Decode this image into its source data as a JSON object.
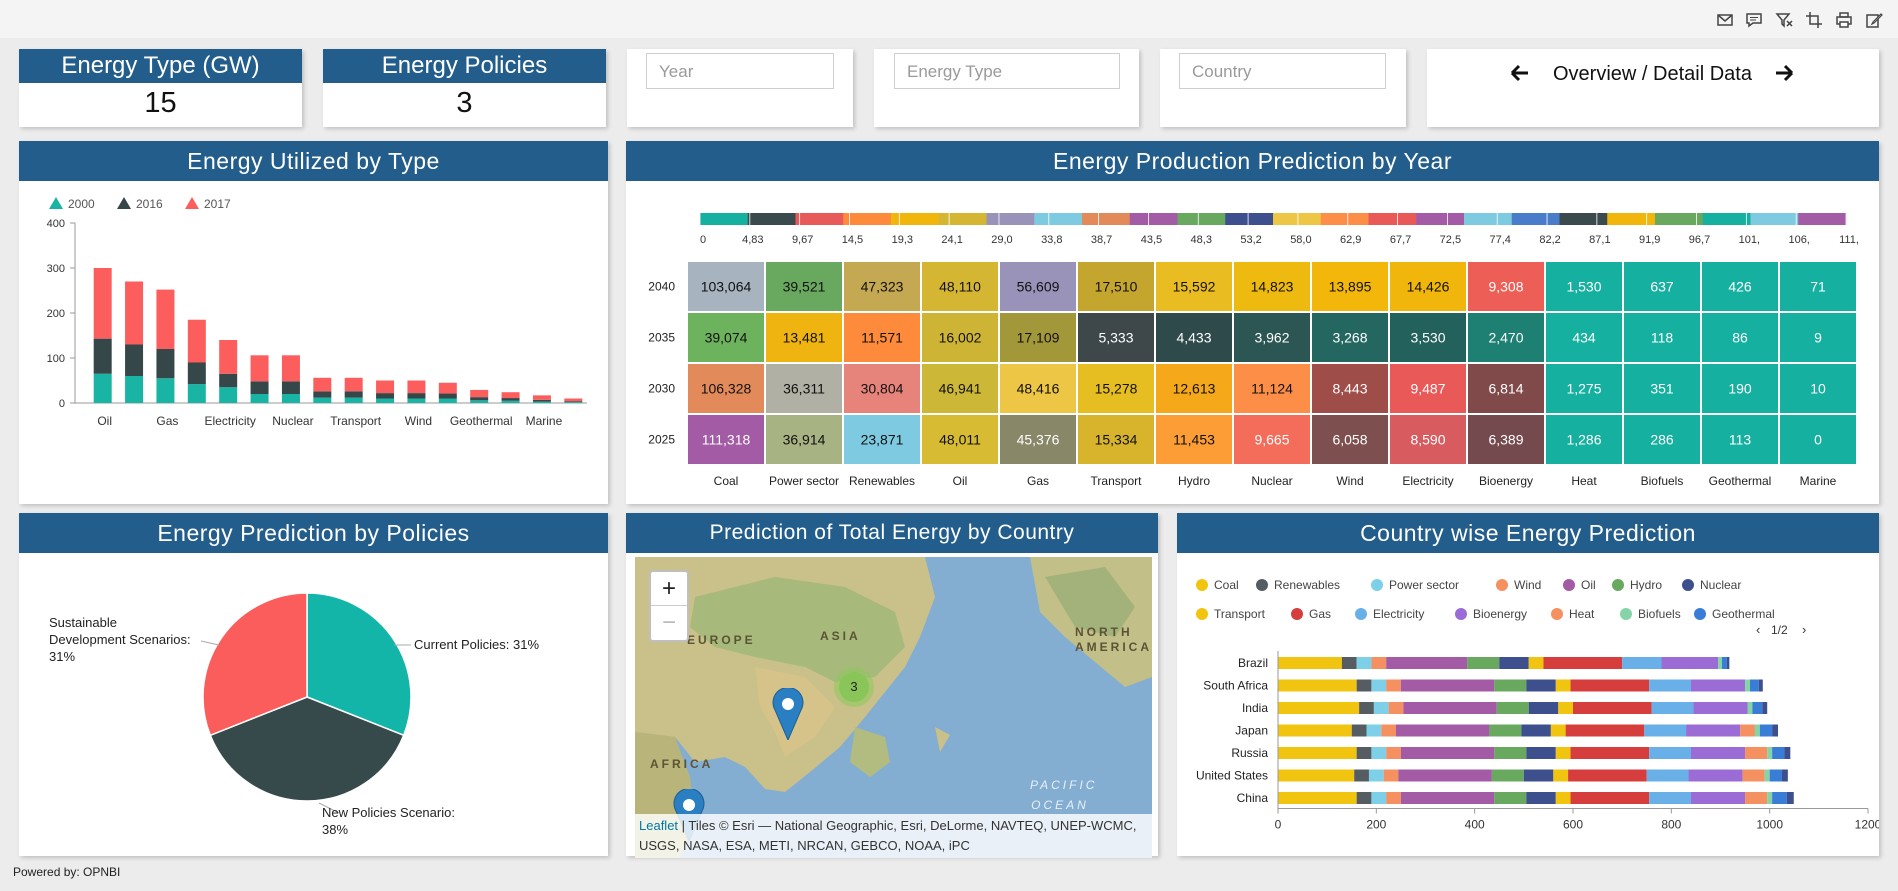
{
  "toolbar": {
    "icons": [
      "mail-icon",
      "comment-icon",
      "filter-clear-icon",
      "crop-icon",
      "print-icon",
      "edit-icon"
    ]
  },
  "kpis": [
    {
      "title": "Energy Type (GW)",
      "value": "15"
    },
    {
      "title": "Energy Policies",
      "value": "3"
    }
  ],
  "filters": {
    "year_placeholder": "Year",
    "energy_type_placeholder": "Energy Type",
    "country_placeholder": "Country"
  },
  "nav": {
    "label": "Overview / Detail Data"
  },
  "panels": {
    "utilized": "Energy Utilized by Type",
    "production": "Energy Production Prediction by Year",
    "policies": "Energy Prediction by Policies",
    "map": "Prediction of Total Energy by Country",
    "country": "Country wise Energy Prediction"
  },
  "map": {
    "labels": [
      "EUROPE",
      "ASIA",
      "AFRICA",
      "NORTH AMERICA",
      "PACIFIC OCEAN"
    ],
    "cluster_count": "3",
    "zoom_in": "+",
    "zoom_out": "−",
    "attribution_link": "Leaflet",
    "attribution_text": " | Tiles © Esri — National Geographic, Esri, DeLorme, NAVTEQ, UNEP-WCMC, USGS, NASA, ESA, METI, NRCAN, GEBCO, NOAA, iPC"
  },
  "footer": "Powered by: OPNBI",
  "chart_data": [
    {
      "type": "bar",
      "stacked": true,
      "categories": [
        "Oil",
        "Gas",
        "Electricity",
        "Nuclear",
        "Transport",
        "Wind",
        "Geothermal",
        "Marine"
      ],
      "bar_labels": [
        "Oil",
        "",
        "Gas",
        "",
        "Electricity",
        "",
        "Nuclear",
        "",
        "Transport",
        "",
        "Wind",
        "",
        "Geothermal",
        "",
        "Marine",
        ""
      ],
      "series": [
        {
          "name": "2000",
          "color": "#1ab4a4",
          "values": [
            65,
            60,
            55,
            42,
            35,
            20,
            20,
            12,
            12,
            10,
            10,
            10,
            6,
            5,
            3,
            2
          ]
        },
        {
          "name": "2016",
          "color": "#36474a",
          "values": [
            78,
            70,
            65,
            48,
            30,
            28,
            28,
            14,
            14,
            12,
            12,
            11,
            7,
            6,
            4,
            2
          ]
        },
        {
          "name": "2017",
          "color": "#fc5e5e",
          "values": [
            157,
            140,
            132,
            95,
            75,
            58,
            58,
            30,
            30,
            28,
            28,
            24,
            16,
            13,
            10,
            6
          ]
        }
      ],
      "ylim": [
        0,
        400
      ],
      "yticks": [
        0,
        100,
        200,
        300,
        400
      ],
      "legend": "top-left"
    },
    {
      "type": "heatmap",
      "x": [
        "Coal",
        "Power sector",
        "Renewables",
        "Oil",
        "Gas",
        "Transport",
        "Hydro",
        "Nuclear",
        "Wind",
        "Electricity",
        "Bioenergy",
        "Heat",
        "Biofuels",
        "Geothermal",
        "Marine"
      ],
      "y": [
        "2040",
        "2035",
        "2030",
        "2025"
      ],
      "values": [
        [
          "103,064",
          "39,521",
          "47,323",
          "48,110",
          "56,609",
          "17,510",
          "15,592",
          "14,823",
          "13,895",
          "14,426",
          "9,308",
          "1,530",
          "637",
          "426",
          "71"
        ],
        [
          "39,074",
          "13,481",
          "11,571",
          "16,002",
          "17,109",
          "5,333",
          "4,433",
          "3,962",
          "3,268",
          "3,530",
          "2,470",
          "434",
          "118",
          "86",
          "9"
        ],
        [
          "106,328",
          "36,311",
          "30,804",
          "46,941",
          "48,416",
          "15,278",
          "12,613",
          "11,124",
          "8,443",
          "9,487",
          "6,814",
          "1,275",
          "351",
          "190",
          "10"
        ],
        [
          "111,318",
          "36,914",
          "23,871",
          "48,011",
          "45,376",
          "15,334",
          "11,453",
          "9,665",
          "6,058",
          "8,590",
          "6,389",
          "1,286",
          "286",
          "113",
          "0"
        ]
      ],
      "cell_colors": [
        [
          "#a7b4bf",
          "#68a95f",
          "#c4a852",
          "#d5b633",
          "#9a93b9",
          "#c4a52e",
          "#e9bd22",
          "#efba10",
          "#f2b70a",
          "#f1b60c",
          "#ec5e56",
          "#15b09f",
          "#15b09f",
          "#15b09f",
          "#15b09f"
        ],
        [
          "#6db25d",
          "#efb40f",
          "#fd8b3b",
          "#ceb434",
          "#a29839",
          "#3e4749",
          "#2f4a4b",
          "#2c5653",
          "#246660",
          "#23625c",
          "#1d8072",
          "#15b09f",
          "#15b09f",
          "#15b09f",
          "#15b09f"
        ],
        [
          "#e38a5b",
          "#b1b0a4",
          "#e6837a",
          "#ccb836",
          "#edc645",
          "#e6be21",
          "#f6a81b",
          "#fd8e48",
          "#9f4d48",
          "#e85958",
          "#804a4a",
          "#15b09f",
          "#15b09f",
          "#15b09f",
          "#15b09f"
        ],
        [
          "#a45ba6",
          "#a7b382",
          "#7ecbe1",
          "#d6bb33",
          "#888768",
          "#d7b42b",
          "#fd9d35",
          "#f46c5a",
          "#7d4f4e",
          "#d85b60",
          "#744a4e",
          "#15b09f",
          "#15b09f",
          "#15b09f",
          "#15b09f"
        ]
      ],
      "colorscale_ticks": [
        "0",
        "4,83",
        "9,67",
        "14,5",
        "19,3",
        "24,1",
        "29,0",
        "33,8",
        "38,7",
        "43,5",
        "48,3",
        "53,2",
        "58,0",
        "62,9",
        "67,7",
        "72,5",
        "77,4",
        "82,2",
        "87,1",
        "91,9",
        "96,7",
        "101,",
        "106,",
        "111,"
      ],
      "colorscale": [
        "#15b09f",
        "#3b4a4c",
        "#e85a5a",
        "#fd8b3b",
        "#f1b60c",
        "#d5b633",
        "#9a93b9",
        "#7ecbe1",
        "#e38a5b",
        "#a45ba6",
        "#68a95f",
        "#3e4f8e",
        "#edc645",
        "#fd8e48",
        "#e85958",
        "#a45ba6",
        "#7ecbe1",
        "#4a7dc9",
        "#3b4a4c",
        "#f1b60c",
        "#68a95f",
        "#15b09f",
        "#7ecbe1",
        "#a45ba6"
      ]
    },
    {
      "type": "pie",
      "slices": [
        {
          "label": "Current Policies: 31%",
          "value": 31,
          "color": "#12b5a7"
        },
        {
          "label": "New Policies Scenario: 38%",
          "value": 38,
          "color": "#364a4b"
        },
        {
          "label": "Sustainable Development Scenarios: 31%",
          "value": 31,
          "color": "#fb5c5c"
        }
      ]
    },
    {
      "type": "bar",
      "orientation": "horizontal",
      "stacked": true,
      "page": "1/2",
      "categories": [
        "Brazil",
        "South Africa",
        "India",
        "Japan",
        "Russia",
        "United States",
        "China"
      ],
      "series": [
        {
          "name": "Coal",
          "color": "#f1c40f",
          "values": [
            130,
            160,
            165,
            150,
            160,
            155,
            160
          ]
        },
        {
          "name": "Renewables",
          "color": "#555d63",
          "values": [
            30,
            30,
            30,
            30,
            30,
            30,
            30
          ]
        },
        {
          "name": "Power sector",
          "color": "#7ed0e8",
          "values": [
            30,
            30,
            30,
            30,
            30,
            30,
            30
          ]
        },
        {
          "name": "Wind",
          "color": "#f59060",
          "values": [
            30,
            30,
            30,
            30,
            30,
            30,
            30
          ]
        },
        {
          "name": "Oil",
          "color": "#a45ba6",
          "values": [
            165,
            190,
            190,
            190,
            190,
            190,
            190
          ]
        },
        {
          "name": "Hydro",
          "color": "#68a95f",
          "values": [
            65,
            65,
            65,
            65,
            65,
            65,
            65
          ]
        },
        {
          "name": "Nuclear",
          "color": "#3e4f8e",
          "values": [
            60,
            60,
            60,
            60,
            60,
            60,
            60
          ]
        },
        {
          "name": "Transport",
          "color": "#f1c40f",
          "values": [
            30,
            30,
            30,
            30,
            30,
            30,
            30
          ]
        },
        {
          "name": "Gas",
          "color": "#d63d3d",
          "values": [
            160,
            160,
            160,
            160,
            160,
            160,
            160
          ]
        },
        {
          "name": "Electricity",
          "color": "#6ab0e8",
          "values": [
            80,
            85,
            85,
            85,
            85,
            85,
            85
          ]
        },
        {
          "name": "Bioenergy",
          "color": "#9b6bd6",
          "values": [
            115,
            110,
            110,
            110,
            110,
            110,
            110
          ]
        },
        {
          "name": "Heat",
          "color": "#f59060",
          "values": [
            0,
            0,
            0,
            30,
            45,
            45,
            45
          ]
        },
        {
          "name": "Biofuels",
          "color": "#85d4a8",
          "values": [
            8,
            10,
            10,
            10,
            10,
            10,
            10
          ]
        },
        {
          "name": "Geothermal",
          "color": "#3a7dd6",
          "values": [
            10,
            18,
            20,
            25,
            25,
            25,
            30
          ]
        }
      ],
      "extra_tail": [
        5,
        8,
        10,
        12,
        12,
        12,
        14
      ],
      "xlim": [
        0,
        1200
      ],
      "xticks": [
        0,
        200,
        400,
        600,
        800,
        1000,
        1200
      ],
      "legend": "top"
    }
  ]
}
